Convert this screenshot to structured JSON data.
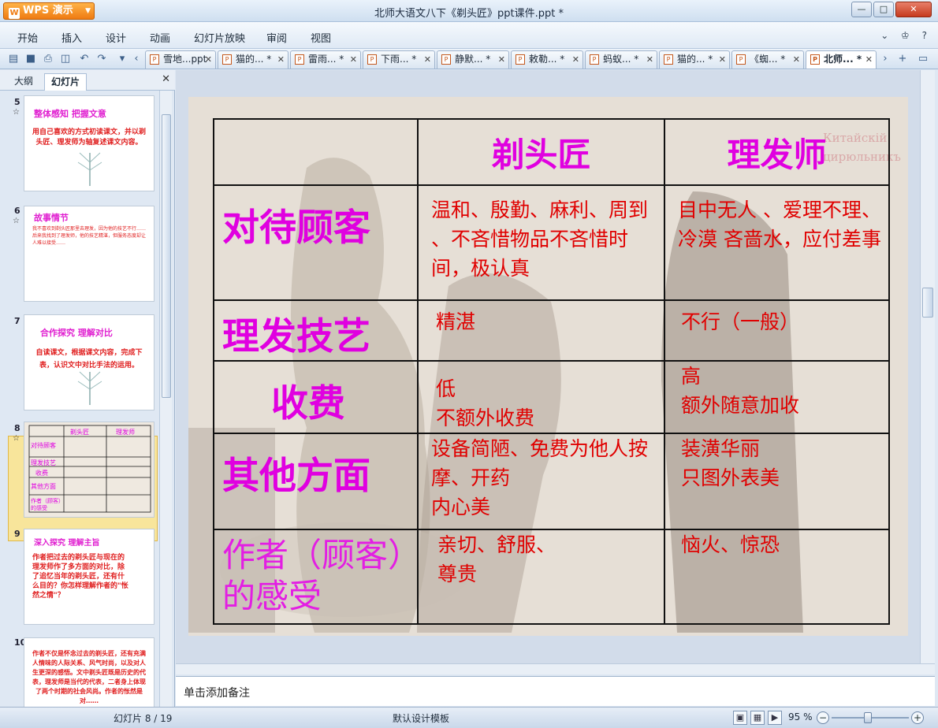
{
  "app": {
    "name": "WPS 演示",
    "logo": "W"
  },
  "window": {
    "title": "北师大语文八下《剃头匠》ppt课件.ppt *",
    "minimize": "—",
    "maximize": "□",
    "close": "✕"
  },
  "menu": {
    "items": [
      "开始",
      "插入",
      "设计",
      "动画",
      "幻灯片放映",
      "审阅",
      "视图"
    ],
    "right": "⌄ ♔ ?"
  },
  "tabs": [
    {
      "label": "雪地...ppt",
      "close": "✕"
    },
    {
      "label": "猫的... *",
      "close": "✕"
    },
    {
      "label": "雷雨... *",
      "close": "✕"
    },
    {
      "label": "下雨... *",
      "close": "✕"
    },
    {
      "label": "静默... *",
      "close": "✕"
    },
    {
      "label": "敕勒... *",
      "close": "✕"
    },
    {
      "label": "蚂蚁... *",
      "close": "✕"
    },
    {
      "label": "猫的... *",
      "close": "✕"
    },
    {
      "label": "《蜘... *",
      "close": "✕"
    },
    {
      "label": "北师... *",
      "close": "✕"
    }
  ],
  "left_pane": {
    "tab_outline": "大纲",
    "tab_slides": "幻灯片",
    "close": "✕",
    "thumbnails": [
      {
        "number": "5",
        "star": "☆",
        "title": "整体感知  把握文意",
        "body": "用自己喜欢的方式初读课文，并以剃头匠、理发师为轴复述课文内容。"
      },
      {
        "number": "6",
        "star": "☆",
        "title": "故事情节",
        "body": "我不喜欢到剃头匠那里去理发，因为他的技艺不行……后来我找到了理发师，他的技艺精湛，但服务态度却让人难以接受……"
      },
      {
        "number": "7",
        "star": "",
        "title": "合作探究  理解对比",
        "body": "自读课文，根据课文内容，完成下表，认识文中对比手法的运用。"
      },
      {
        "number": "8",
        "star": "☆",
        "title": "",
        "body": ""
      },
      {
        "number": "9",
        "star": "",
        "title": "深入探究  理解主旨",
        "body": "作者把过去的剃头匠与现在的理发师作了多方面的对比，除了追忆当年的剃头匠，还有什么目的？你怎样理解作者的\"怅然之情\"？"
      },
      {
        "number": "10",
        "star": "",
        "title": "",
        "body": "作者不仅是怀念过去的剃头匠，还有充满人情味的人际关系、风气时尚，以及对人生更深的感悟。文中剃头匠既是历史的代表，理发师是当代的代表，二者身上体现了两个时期的社会风尚。作者的怅然是对……"
      }
    ],
    "thumb8_headers": [
      "剃头匠",
      "理发师"
    ],
    "thumb8_rows": [
      "对待顾客",
      "理发技艺",
      "收费",
      "其他方面",
      "作者（顾客）的感受"
    ]
  },
  "slide": {
    "headers": [
      "",
      "剃头匠",
      "理发师"
    ],
    "rows": [
      {
        "label": "对待顾客",
        "barber_old": "温和、殷勤、麻利、周到 、不吝惜物品不吝惜时间，极认真",
        "barber_new": "目中无人 、爱理不理、冷漠  吝啬水，应付差事"
      },
      {
        "label": "理发技艺",
        "barber_old": "精湛",
        "barber_new": "不行（一般）"
      },
      {
        "label": "收费",
        "barber_old": "低\n不额外收费",
        "barber_new": "高\n额外随意加收"
      },
      {
        "label": "其他方面",
        "barber_old": "设备简陋、免费为他人按摩、开药\n内心美",
        "barber_new": "装潢华丽\n只图外表美"
      },
      {
        "label": "作者（顾客）的感受",
        "barber_old": "亲切、舒服、\n尊贵",
        "barber_new": "恼火、惊恐"
      }
    ],
    "watermark": "Китайскій\nцирюльникъ"
  },
  "notes": {
    "placeholder": "单击添加备注"
  },
  "status": {
    "slide_position": "幻灯片 8 / 19",
    "template": "默认设计模板",
    "zoom": "95 %",
    "zoom_level_percent": 95
  },
  "colors": {
    "accent_magenta": "#e000e0",
    "text_red": "#e00000",
    "selection": "#f8e59b"
  }
}
